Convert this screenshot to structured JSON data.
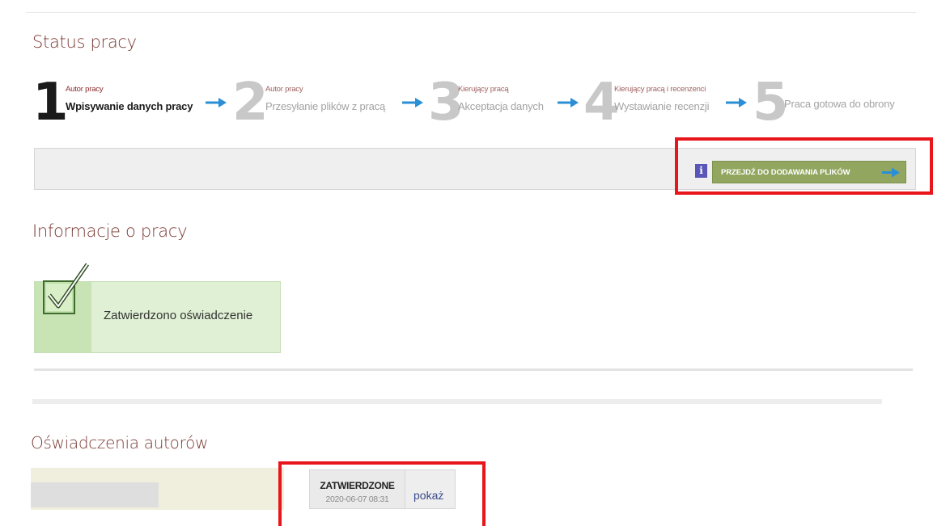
{
  "status_section": {
    "title": "Status pracy",
    "steps": [
      {
        "number": "1",
        "role": "Autor pracy",
        "name": "Wpisywanie danych pracy",
        "active": true
      },
      {
        "number": "2",
        "role": "Autor pracy",
        "name": "Przesyłanie plików z pracą",
        "active": false
      },
      {
        "number": "3",
        "role": "Kierujący pracą",
        "name": "Akceptacja danych",
        "active": false
      },
      {
        "number": "4",
        "role": "Kierujący pracą i recenzenci",
        "name": "Wystawianie recenzji",
        "active": false
      },
      {
        "number": "5",
        "role": "",
        "name": "Praca gotowa do obrony",
        "active": false
      }
    ],
    "info_icon": "i",
    "go_to_files_label": "PRZEJDŹ DO DODAWANIA PLIKÓW"
  },
  "info_section": {
    "title": "Informacje o pracy",
    "confirmation_text": "Zatwierdzono oświadczenie"
  },
  "authors_section": {
    "title": "Oświadczenia autorów",
    "rows": [
      {
        "status": "ZATWIERDZONE",
        "date": "2020-06-07 08:31",
        "action": "pokaż"
      }
    ]
  },
  "colors": {
    "title": "#7a3a34",
    "step_arrow": "#2b8fd6",
    "button": "#92a660",
    "highlight": "#e8151a",
    "confirm_bg": "#dff0d4"
  },
  "icons": [
    "arrow-right-icon",
    "info-icon",
    "checkmark-icon"
  ]
}
